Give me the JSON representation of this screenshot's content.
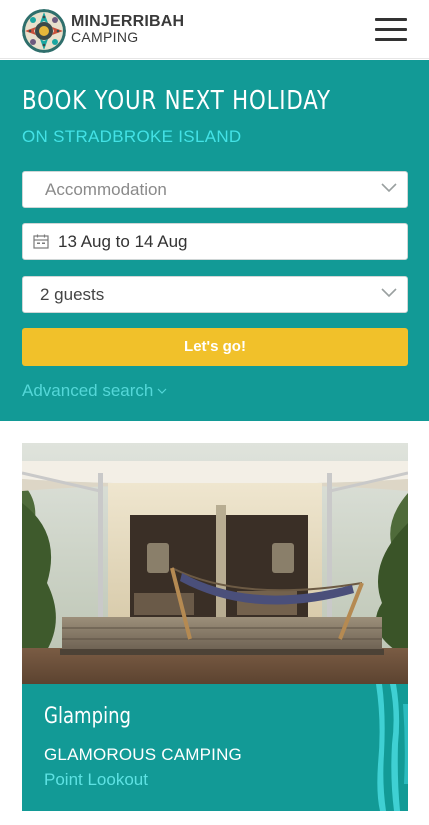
{
  "header": {
    "logo_line1": "MINJERRIBAH",
    "logo_line2": "CAMPING",
    "menu_icon": "hamburger-menu-icon"
  },
  "booking": {
    "title": "BOOK YOUR NEXT HOLIDAY",
    "subtitle": "ON STRADBROKE ISLAND",
    "accommodation": {
      "value": "Accommodation",
      "icon": "chevron-down-icon"
    },
    "dates": {
      "value": "13 Aug to 14 Aug",
      "icon": "calendar-icon"
    },
    "guests": {
      "value": "2 guests",
      "icon": "chevron-down-icon"
    },
    "submit_label": "Let's go!",
    "advanced_search_label": "Advanced search"
  },
  "card": {
    "title": "Glamping",
    "subtitle": "GLAMOROUS CAMPING",
    "location": "Point Lookout"
  },
  "colors": {
    "teal": "#129a96",
    "cyan_text": "#43e2e6",
    "button_yellow": "#f1c12a",
    "header_text": "#3a3a3a"
  }
}
